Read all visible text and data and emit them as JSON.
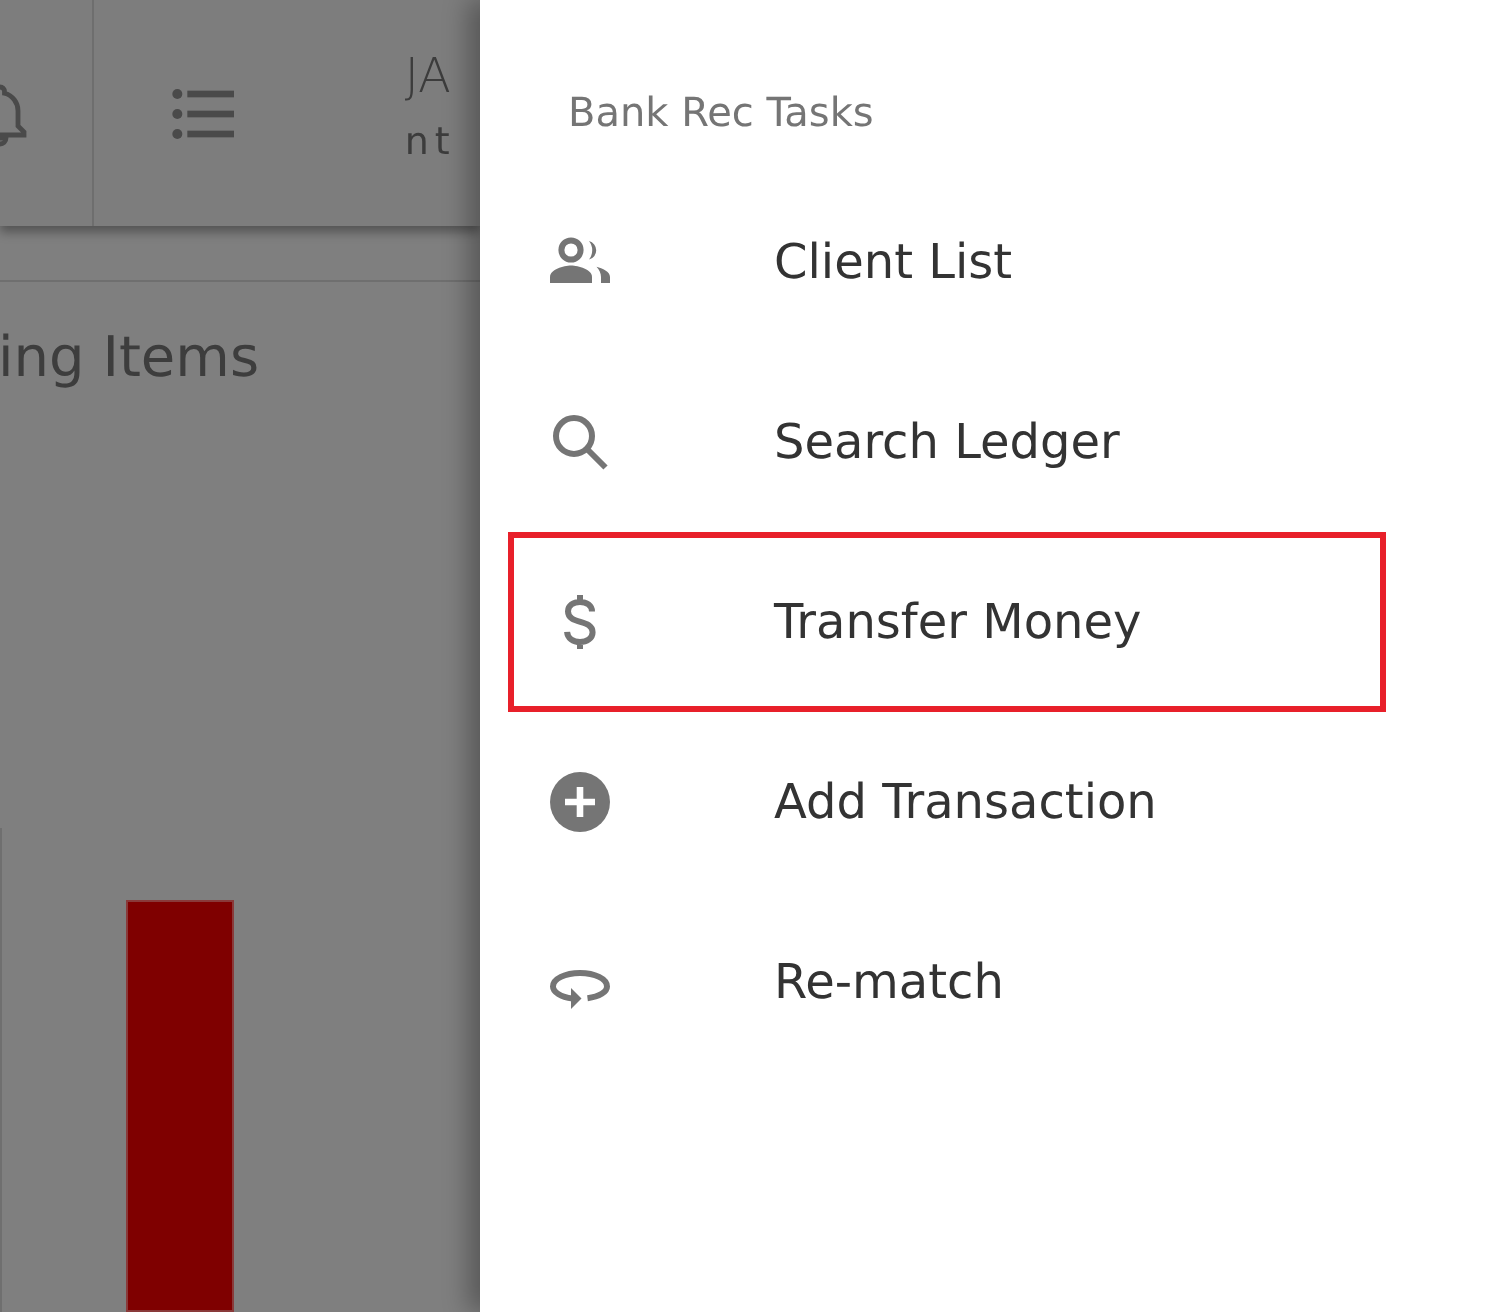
{
  "background": {
    "header": {
      "line_1": "JA",
      "line_2": "nt"
    },
    "heading": "ing Items"
  },
  "drawer": {
    "title": "Bank Rec Tasks",
    "items": [
      {
        "kind": "people",
        "label": "Client List",
        "highlighted": false
      },
      {
        "kind": "search",
        "label": "Search Ledger",
        "highlighted": false
      },
      {
        "kind": "dollar",
        "label": "Transfer Money",
        "highlighted": true
      },
      {
        "kind": "add",
        "label": "Add Transaction",
        "highlighted": false
      },
      {
        "kind": "rematch",
        "label": "Re-match",
        "highlighted": false
      }
    ]
  }
}
